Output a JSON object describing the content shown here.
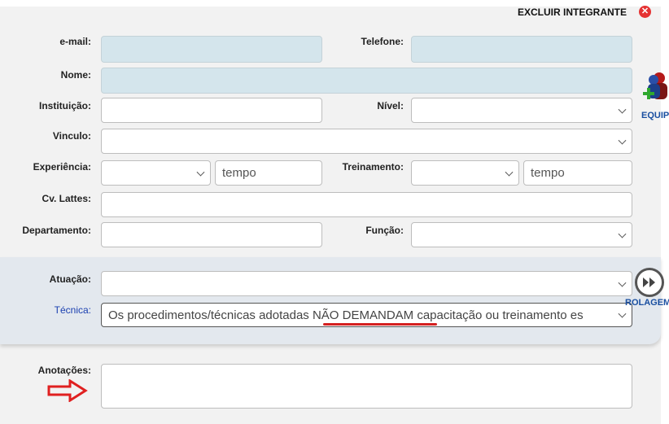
{
  "header": {
    "excluir_label": "EXCLUIR INTEGRANTE",
    "excluir_icon": "close-circle-icon"
  },
  "form": {
    "email_label": "e-mail:",
    "email_value": "",
    "telefone_label": "Telefone:",
    "telefone_value": "",
    "nome_label": "Nome:",
    "nome_value": "",
    "instituicao_label": "Instituição:",
    "instituicao_value": "",
    "nivel_label": "Nível:",
    "nivel_value": "",
    "vinculo_label": "Vinculo:",
    "vinculo_value": "",
    "experiencia_label": "Experiência:",
    "experiencia_value": "",
    "experiencia_tempo_placeholder": "tempo",
    "treinamento_label": "Treinamento:",
    "treinamento_value": "",
    "treinamento_tempo_placeholder": "tempo",
    "lattes_label": "Cv. Lattes:",
    "lattes_value": "",
    "departamento_label": "Departamento:",
    "departamento_value": "",
    "funcao_label": "Função:",
    "funcao_value": ""
  },
  "atuacao": {
    "atuacao_label": "Atuação:",
    "atuacao_value": "",
    "tecnica_label": "Técnica:",
    "tecnica_value": "Os procedimentos/técnicas adotadas NÃO DEMANDAM capacitação ou treinamento es"
  },
  "anotacoes": {
    "label": "Anotações:",
    "value": ""
  },
  "side": {
    "equip_label": "EQUIP",
    "rolagem_label": "ROLAGEM"
  },
  "colors": {
    "readonly_field": "#d4e5ec",
    "label_blue": "#1a3fb0",
    "accent_red": "#d42020"
  }
}
